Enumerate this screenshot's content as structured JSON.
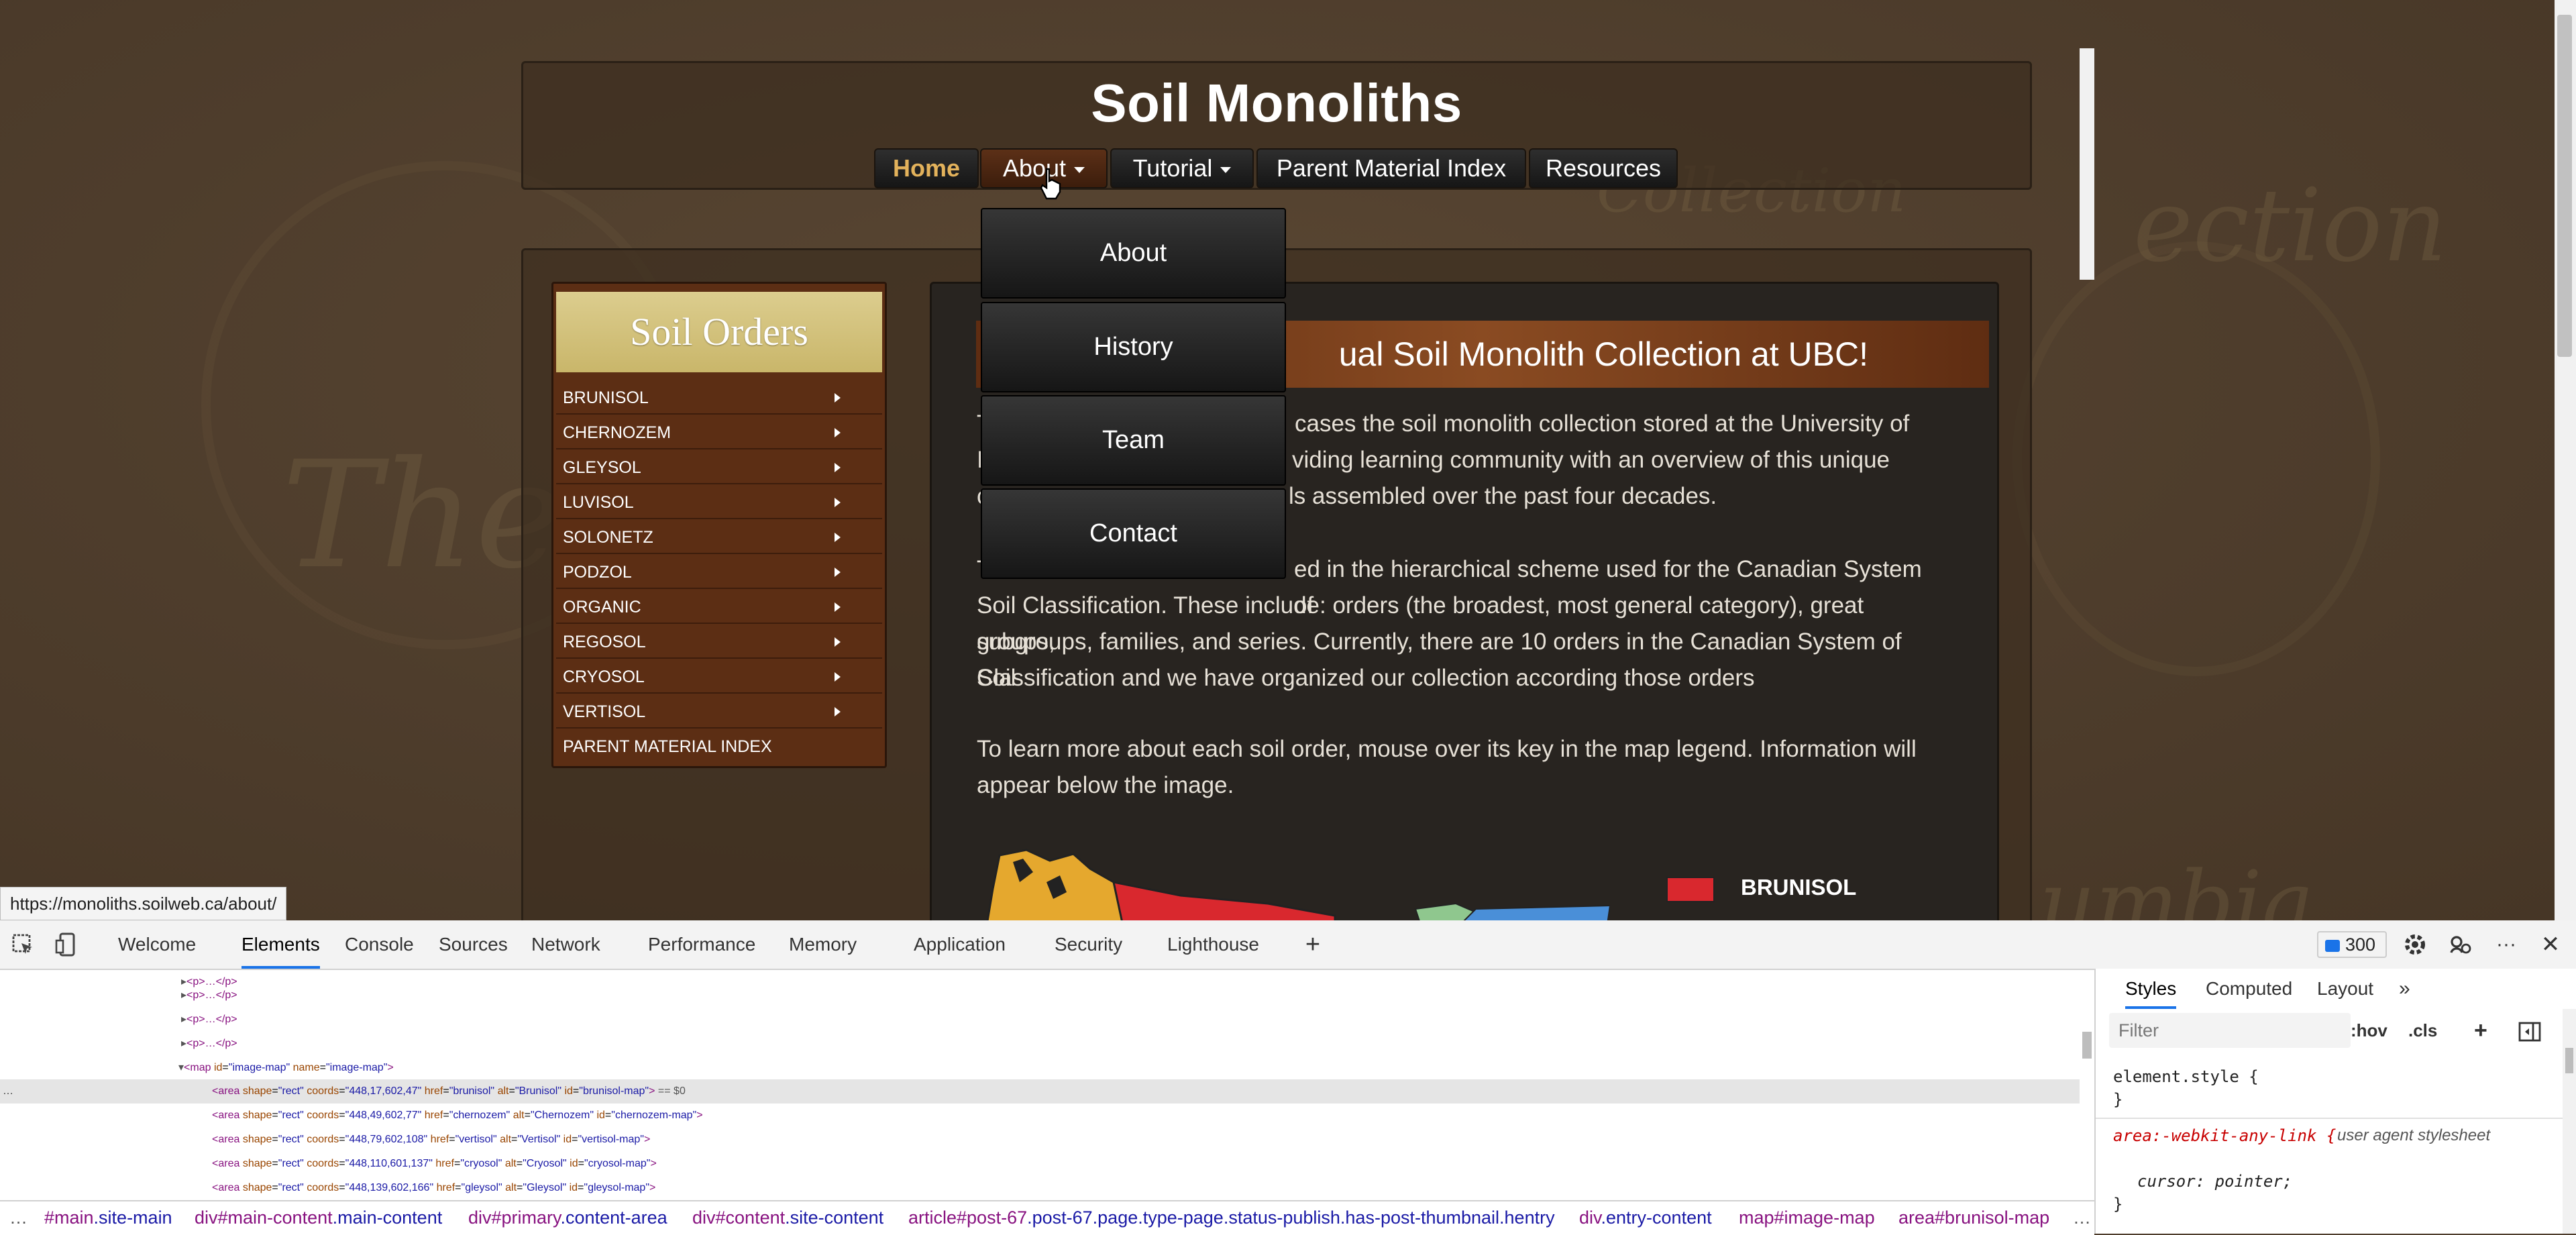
{
  "page": {
    "title": "Soil Monoliths",
    "nav": {
      "home": "Home",
      "about": "About",
      "tutorial": "Tutorial",
      "parent_material_index": "Parent Material Index",
      "resources": "Resources"
    },
    "about_dropdown": [
      "About",
      "History",
      "Team",
      "Contact"
    ],
    "sidebar": {
      "title": "Soil Orders",
      "items": [
        "BRUNISOL",
        "CHERNOZEM",
        "GLEYSOL",
        "LUVISOL",
        "SOLONETZ",
        "PODZOL",
        "ORGANIC",
        "REGOSOL",
        "CRYOSOL",
        "VERTISOL",
        "PARENT MATERIAL INDEX"
      ]
    },
    "main": {
      "welcome_title": "ual Soil Monolith Collection at UBC!",
      "para1_lines": [
        "cases the soil monolith collection stored at the University of",
        "viding learning community with an overview of this unique",
        "ls assembled over the past four decades."
      ],
      "para1_frag": [
        "T",
        "I",
        "c"
      ],
      "para2_line1_tail": "ed in the hierarchical scheme used for the Canadian System of",
      "para2_line1_head": "T",
      "para2_lines": [
        "Soil Classification. These include: orders (the broadest, most general category), great groups,",
        "subgroups, families, and series. Currently, there are 10 orders in the Canadian System of Soil",
        "Classification and we have organized our collection according those orders"
      ],
      "para3_lines": [
        "To learn more about each soil order, mouse over its key in the map legend. Information will",
        "appear below the image."
      ],
      "legend_label": "BRUNISOL"
    },
    "watermarks": [
      "The",
      "Collection",
      "ection",
      "umbia"
    ],
    "status_url": "https://monoliths.soilweb.ca/about/"
  },
  "devtools": {
    "tabs": [
      "Welcome",
      "Elements",
      "Console",
      "Sources",
      "Network",
      "Performance",
      "Memory",
      "Application",
      "Security",
      "Lighthouse"
    ],
    "selected_tab": "Elements",
    "issues_count": "300",
    "elements": {
      "p_collapsed": "<p>…</p>",
      "map_open": [
        "<map",
        "id",
        "image-map",
        "name",
        "image-map"
      ],
      "areas": [
        {
          "coords": "448,17,602,47",
          "href": "brunisol",
          "alt": "Brunisol",
          "id": "brunisol-map"
        },
        {
          "coords": "448,49,602,77",
          "href": "chernozem",
          "alt": "Chernozem",
          "id": "chernozem-map"
        },
        {
          "coords": "448,79,602,108",
          "href": "vertisol",
          "alt": "Vertisol",
          "id": "vertisol-map"
        },
        {
          "coords": "448,110,601,137",
          "href": "cryosol",
          "alt": "Cryosol",
          "id": "cryosol-map"
        },
        {
          "coords": "448,139,602,166",
          "href": "gleysol",
          "alt": "Gleysol",
          "id": "gleysol-map"
        }
      ],
      "selected_marker": "== $0"
    },
    "styles": {
      "tabs": [
        "Styles",
        "Computed",
        "Layout"
      ],
      "filter_placeholder": "Filter",
      "hov": ":hov",
      "cls": ".cls",
      "rule1": [
        "element.style {",
        "}"
      ],
      "rule2_selector": "area:-webkit-any-link {",
      "rule2_source": "user agent stylesheet",
      "rule2_decl": "cursor: pointer;",
      "rule2_close": "}"
    },
    "breadcrumb": [
      {
        "tag": "#main",
        "cls": ".site-main"
      },
      {
        "tag": "div#main-content",
        "cls": ".main-content"
      },
      {
        "tag": "div#primary",
        "cls": ".content-area"
      },
      {
        "tag": "div#content",
        "cls": ".site-content"
      },
      {
        "tag": "article#post-67",
        "cls": ".post-67.page.type-page.status-publish.has-post-thumbnail.hentry"
      },
      {
        "tag": "div",
        "cls": ".entry-content"
      },
      {
        "tag": "map#image-map",
        "cls": ""
      },
      {
        "tag": "area#brunisol-map",
        "cls": ""
      }
    ],
    "ellipsis": "…"
  },
  "colors": {
    "accent_home": "#e3b25b",
    "soil_orders_header": "#d3c17c",
    "sidebar_bg": "#5c2e14",
    "legend_brunisol": "#d9282e",
    "devtools_selected": "#1a73e8"
  },
  "icons": [
    "inspect-icon",
    "device-toolbar-icon",
    "add-tab-icon",
    "settings-icon",
    "customize-icon",
    "more-icon",
    "close-icon",
    "new-style-rule-icon",
    "toggle-sidebar-icon",
    "more-tabs-icon"
  ]
}
